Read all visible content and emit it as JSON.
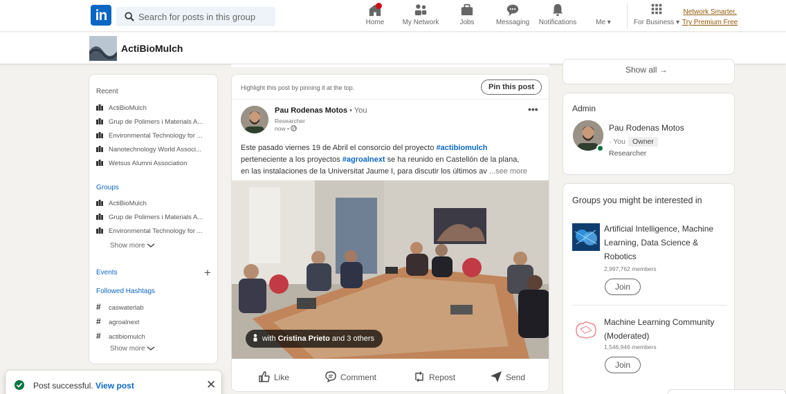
{
  "nav": {
    "logo_text": "in",
    "search_placeholder": "Search for posts in this group",
    "items": [
      {
        "label": "Home",
        "icon": "home-icon"
      },
      {
        "label": "My Network",
        "icon": "network-icon"
      },
      {
        "label": "Jobs",
        "icon": "briefcase-icon"
      },
      {
        "label": "Messaging",
        "icon": "messaging-icon"
      },
      {
        "label": "Notifications",
        "icon": "bell-icon"
      },
      {
        "label": "Me ▾",
        "icon": "avatar"
      },
      {
        "label": "For Business ▾",
        "icon": "grid-icon"
      }
    ],
    "premium_line1": "Network Smarter,",
    "premium_line2": "Try Premium Free"
  },
  "group": {
    "name": "ActiBioMulch"
  },
  "sidebar": {
    "recent_heading": "Recent",
    "recent": [
      "ActiBioMulch",
      "Grup de Polimers i Materials A...",
      "Environmental Technology for ...",
      "Nanotechnology World Associ...",
      "Wetsus Alumni Association"
    ],
    "groups_heading": "Groups",
    "groups": [
      "ActiBioMulch",
      "Grup de Polimers i Materials A...",
      "Environmental Technology for ..."
    ],
    "show_more": "Show more",
    "events_heading": "Events",
    "hashtags_heading": "Followed Hashtags",
    "hashtags": [
      "caswaterlab",
      "agroalnext",
      "actibiomulch"
    ],
    "show_more_2": "Show more"
  },
  "toast": {
    "text": "Post successful.",
    "link": "View post"
  },
  "post": {
    "pin_hint": "Highlight this post by pinning it at the top.",
    "pin_button": "Pin this post",
    "author": "Pau Rodenas Motos",
    "author_suffix": " • You",
    "role": "Researcher",
    "time": "now •",
    "text_1": "Este pasado viernes 19 de Abril el consorcio del proyecto ",
    "hashtag_1": "#actibiomulch",
    "text_2": "perteneciente a los proyectos ",
    "hashtag_2": "#agroalnext",
    "text_3": " se ha reunido en Castellón de la plana,",
    "text_4": "en las instalaciones de la Universitat Jaume I, para discutir los últimos av",
    "see_more": " ...see more",
    "tag_prefix": "with ",
    "tag_name": "Cristina Prieto",
    "tag_suffix": " and 3 others",
    "actions": [
      "Like",
      "Comment",
      "Repost",
      "Send"
    ]
  },
  "right": {
    "show_all": "Show all →",
    "admin_title": "Admin",
    "admin_name": "Pau Rodenas Motos",
    "admin_you": "· You",
    "admin_badge": "Owner",
    "admin_role": "Researcher",
    "interest_title": "Groups you might be interested in",
    "suggestions": [
      {
        "name": "Artificial Intelligence, Machine Learning, Data Science & Robotics",
        "members": "2,997,762 members",
        "join": "Join"
      },
      {
        "name": "Machine Learning Community (Moderated)",
        "members": "1,546,946 members",
        "join": "Join"
      }
    ]
  },
  "colors": {
    "brand": "#0a66c2",
    "success": "#057642",
    "premium": "#915907"
  }
}
